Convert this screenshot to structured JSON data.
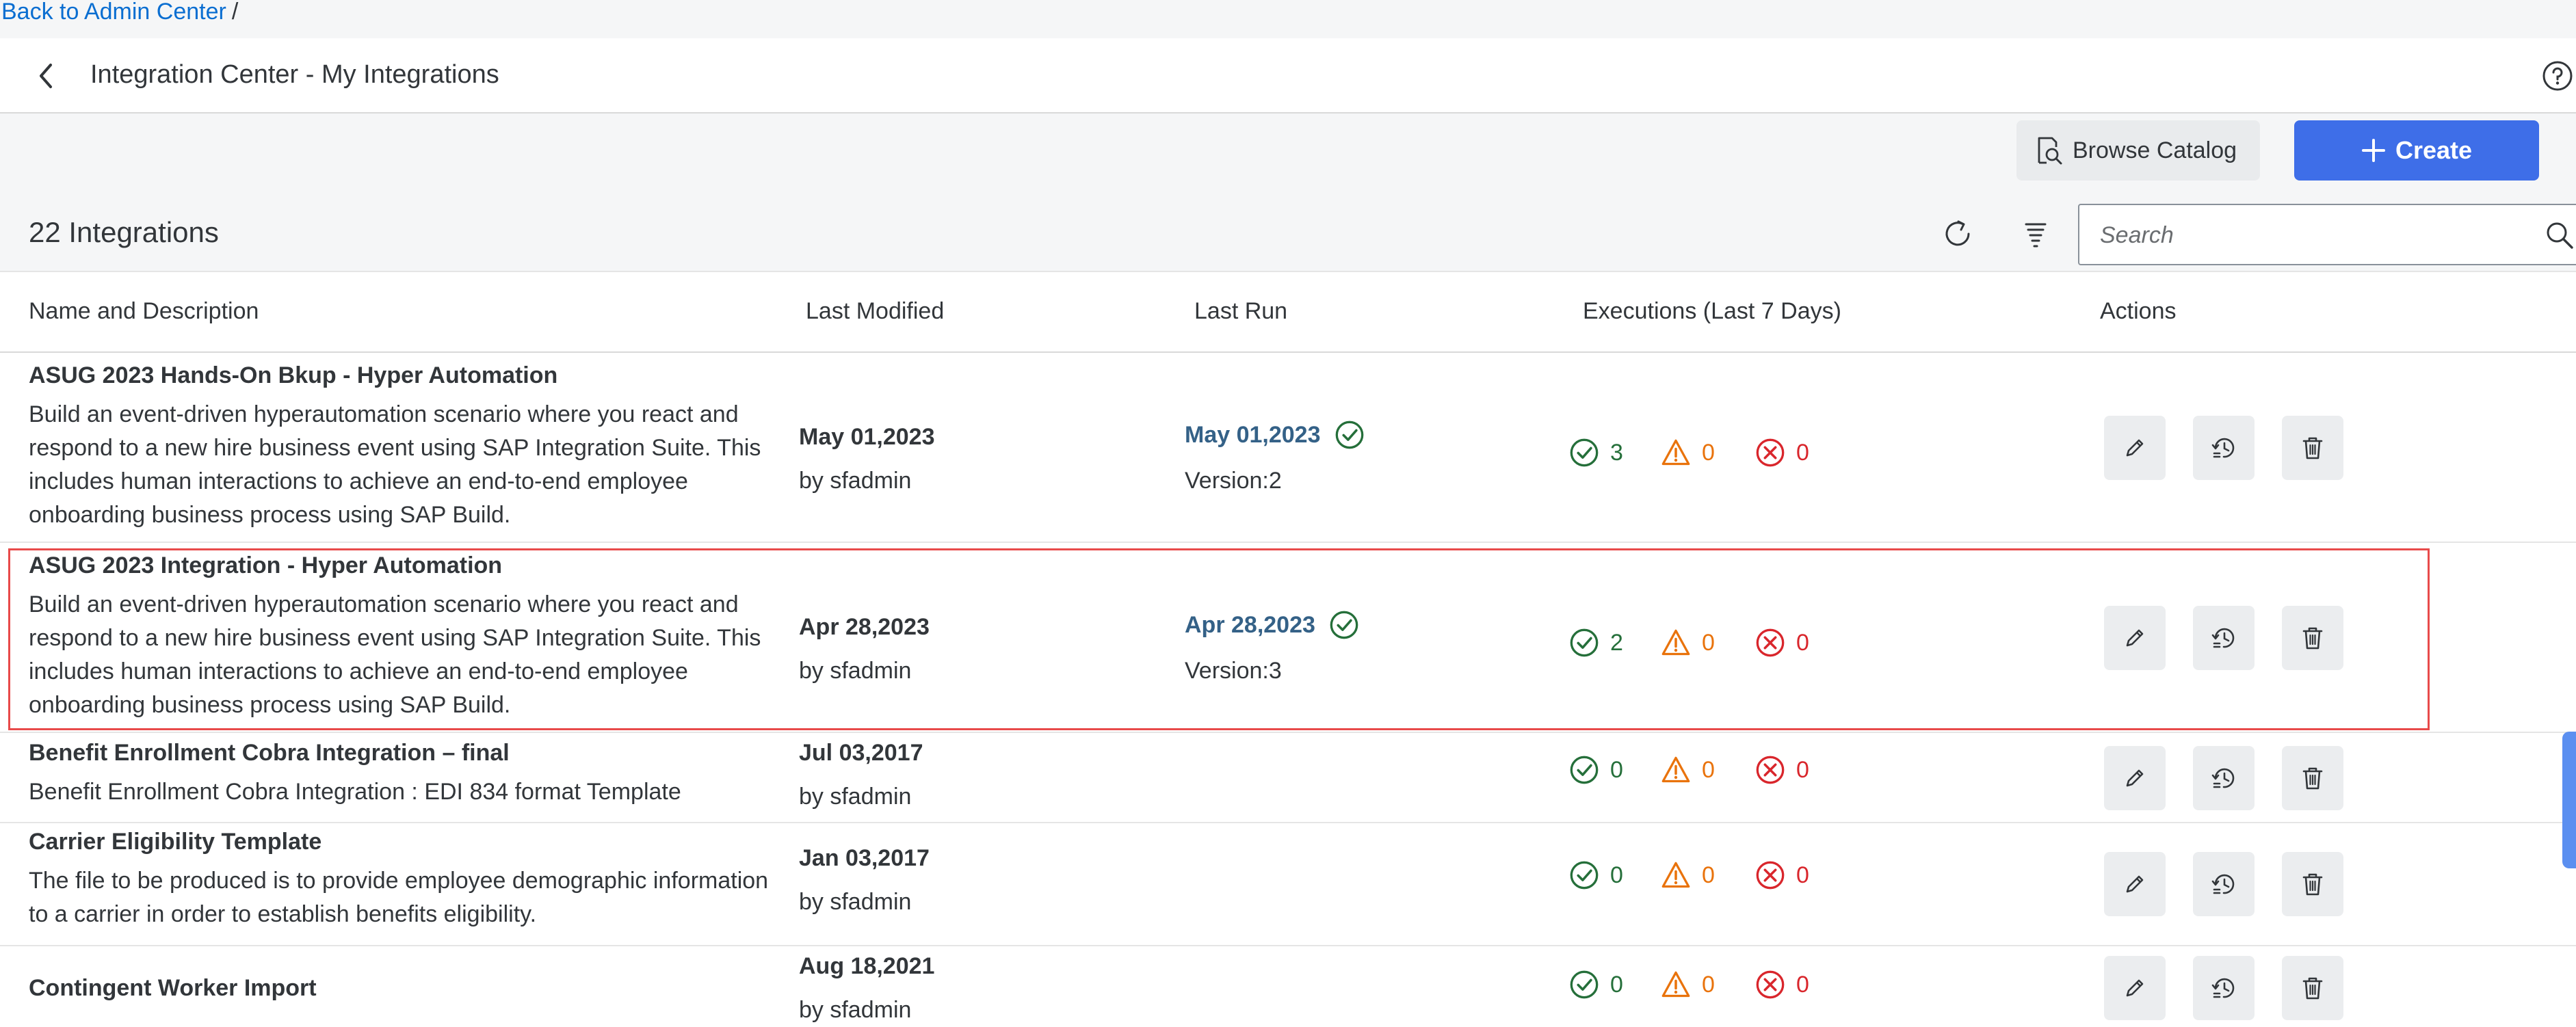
{
  "breadcrumb": {
    "link": "Back to Admin Center",
    "separator": "/"
  },
  "header": {
    "title": "Integration Center - My Integrations"
  },
  "toolbar": {
    "browse_label": "Browse Catalog",
    "create_label": "Create"
  },
  "list": {
    "count_title": "22 Integrations",
    "search_placeholder": "Search",
    "columns": [
      "Name and Description",
      "Last Modified",
      "Last Run",
      "Executions (Last 7 Days)",
      "Actions"
    ]
  },
  "rows": [
    {
      "name": "ASUG 2023 Hands-On Bkup - Hyper Automation",
      "description": "Build an event-driven hyperautomation scenario where you react and respond to a new hire business event using SAP Integration Suite. This includes human interactions to achieve an end-to-end employee onboarding business process using SAP Build.",
      "modified_date": "May 01,2023",
      "modified_by": "by sfadmin",
      "last_run": "May 01,2023",
      "version": "Version:2",
      "exec_ok": "3",
      "exec_warn": "0",
      "exec_err": "0"
    },
    {
      "name": "ASUG 2023 Integration - Hyper Automation",
      "description": "Build an event-driven hyperautomation scenario where you react and respond to a new hire business event using SAP Integration Suite. This includes human interactions to achieve an end-to-end employee onboarding business process using SAP Build.",
      "modified_date": "Apr 28,2023",
      "modified_by": "by sfadmin",
      "last_run": "Apr 28,2023",
      "version": "Version:3",
      "exec_ok": "2",
      "exec_warn": "0",
      "exec_err": "0"
    },
    {
      "name": "Benefit Enrollment Cobra Integration – final",
      "description": "Benefit Enrollment Cobra Integration : EDI 834 format Template",
      "modified_date": "Jul 03,2017",
      "modified_by": "by sfadmin",
      "exec_ok": "0",
      "exec_warn": "0",
      "exec_err": "0"
    },
    {
      "name": "Carrier Eligibility Template",
      "description": "The file to be produced is to provide employee demographic information to a carrier in order to establish benefits eligibility.",
      "modified_date": "Jan 03,2017",
      "modified_by": "by sfadmin",
      "exec_ok": "0",
      "exec_warn": "0",
      "exec_err": "0"
    },
    {
      "name": "Contingent Worker Import",
      "modified_date": "Aug 18,2021",
      "modified_by": "by sfadmin",
      "exec_ok": "0",
      "exec_warn": "0",
      "exec_err": "0"
    }
  ],
  "colors": {
    "accent": "#3e6ee8",
    "success": "#256f3a",
    "warning": "#e9730c",
    "error": "#d9262c",
    "link": "#346187",
    "highlight": "#e84a4a"
  },
  "icons": [
    "chevron-left-icon",
    "help-icon",
    "catalog-icon",
    "plus-icon",
    "refresh-icon",
    "sort-icon",
    "search-icon",
    "check-circle-icon",
    "warning-icon",
    "error-circle-icon",
    "edit-icon",
    "history-icon",
    "delete-icon"
  ]
}
